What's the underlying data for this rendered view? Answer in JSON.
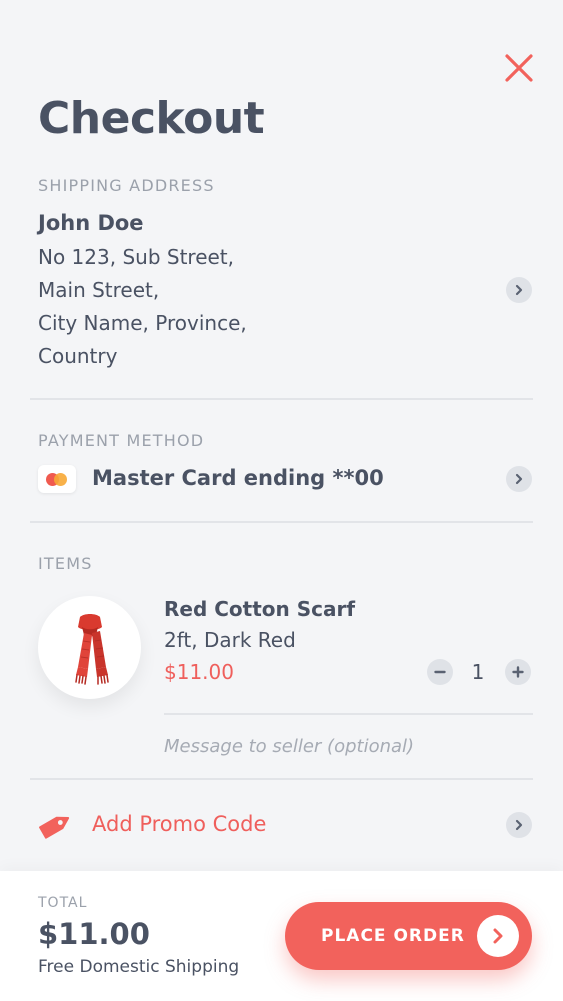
{
  "header": {
    "title": "Checkout",
    "close_icon": "close-icon"
  },
  "shipping": {
    "label": "SHIPPING ADDRESS",
    "name": "John Doe",
    "lines": [
      "No 123, Sub Street,",
      "Main Street,",
      "City Name, Province,",
      "Country"
    ]
  },
  "payment": {
    "label": "PAYMENT METHOD",
    "card_icon": "mastercard-icon",
    "method": "Master Card ending **00"
  },
  "items": {
    "label": "ITEMS",
    "list": [
      {
        "name": "Red Cotton Scarf",
        "variant": "2ft, Dark Red",
        "price": "$11.00",
        "quantity": "1",
        "image_icon": "red-scarf-image"
      }
    ],
    "message_placeholder": "Message to seller (optional)"
  },
  "promo": {
    "icon": "tag-icon",
    "label": "Add Promo Code"
  },
  "footer": {
    "total_label": "TOTAL",
    "total_value": "$11.00",
    "shipping_note": "Free Domestic Shipping",
    "button_label": "PLACE ORDER"
  },
  "colors": {
    "accent": "#f2625c",
    "text": "#4a5263",
    "muted": "#9ba1ab",
    "background": "#f4f5f7"
  }
}
